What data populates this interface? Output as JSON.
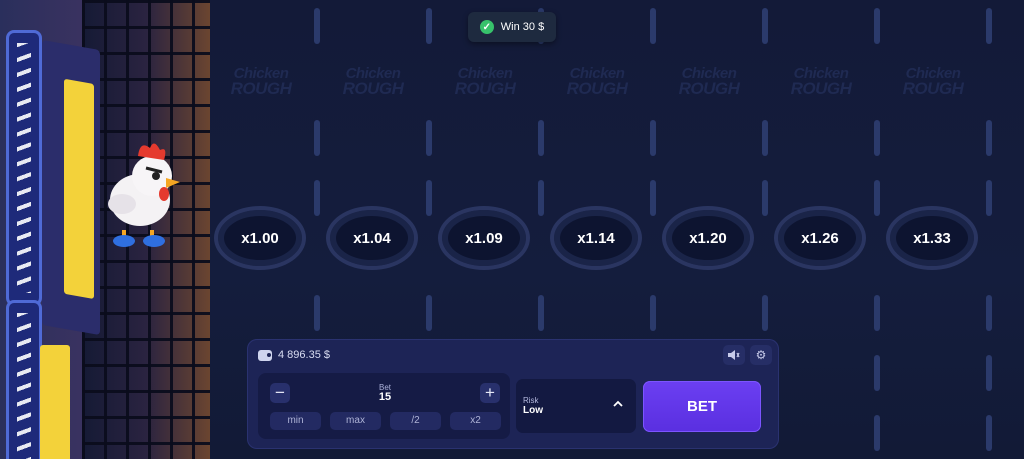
{
  "game": {
    "logo_line1": "Chicken",
    "logo_line2": "ROUGH",
    "multipliers": [
      "x1.00",
      "x1.04",
      "x1.09",
      "x1.14",
      "x1.20",
      "x1.26",
      "x1.33"
    ]
  },
  "toast": {
    "text": "Win 30 $",
    "icon": "check-icon"
  },
  "panel": {
    "balance": "4 896.35 $",
    "bet_label": "Bet",
    "bet_value": "15",
    "minus": "−",
    "plus": "+",
    "quick": [
      "min",
      "max",
      "/2",
      "x2"
    ],
    "risk_label": "Risk",
    "risk_value": "Low",
    "bet_button": "BET",
    "icons": [
      "wallet-icon",
      "sound-icon",
      "settings-icon",
      "chevron-up-icon"
    ]
  },
  "colors": {
    "accent": "#5a2fe0",
    "success": "#37c26b",
    "background": "#141c3a"
  }
}
